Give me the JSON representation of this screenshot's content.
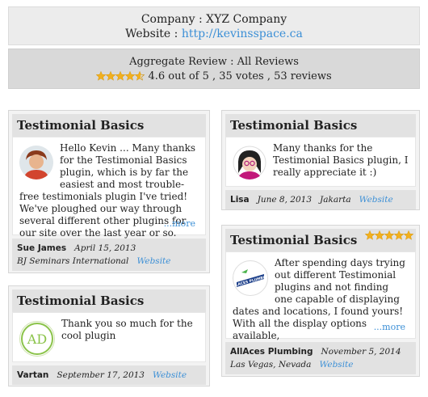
{
  "company": {
    "label": "Company : XYZ Company",
    "website_prefix": "Website :",
    "website_url": "http://kevinsspace.ca"
  },
  "aggregate": {
    "title": "Aggregate Review : All Reviews",
    "rating": 4.6,
    "summary": "4.6 out of 5 , 35 votes , 53 reviews"
  },
  "colors": {
    "link": "#3b8fd6",
    "star": "#f2b01e",
    "star_border": "#c98a00"
  },
  "cards": {
    "c1": {
      "title": "Testimonial Basics",
      "text": "Hello Kevin ... Many thanks for the Testimonial Basics plugin, which is by far the easiest and most trouble-free testimonials plugin I've tried! We've ploughed our way through several different other plugins for our site over the last year or so.",
      "more": "...more",
      "author": "Sue James",
      "date": "April 15, 2013",
      "location": "BJ Seminars International",
      "website": "Website",
      "avatar": "woman-portrait-avatar"
    },
    "c2": {
      "title": "Testimonial Basics",
      "text": "Many thanks for the Testimonial Basics plugin, I really appreciate it :)",
      "author": "Lisa",
      "date": "June 8, 2013",
      "location": "Jakarta",
      "website": "Website",
      "avatar": "cartoon-girl-avatar"
    },
    "c3": {
      "title": "Testimonial Basics",
      "rating": 5,
      "text": "After spending days trying out different Testimonial plugins and not finding one capable of displaying dates and locations, I found yours! With all the display options available,",
      "more": "...more",
      "author": "AllAces Plumbing",
      "date": "November 5, 2014",
      "location": "Las Vegas, Nevada",
      "website": "Website",
      "avatar": "allaces-plumbing-logo",
      "avatar_text": "ALLACES PLUMBING"
    },
    "c4": {
      "title": "Testimonial Basics",
      "text": "Thank you so much for the cool plugin",
      "author": "Vartan",
      "date": "September 17, 2013",
      "website": "Website",
      "avatar": "ad-logo-avatar",
      "avatar_text": "AD"
    }
  }
}
